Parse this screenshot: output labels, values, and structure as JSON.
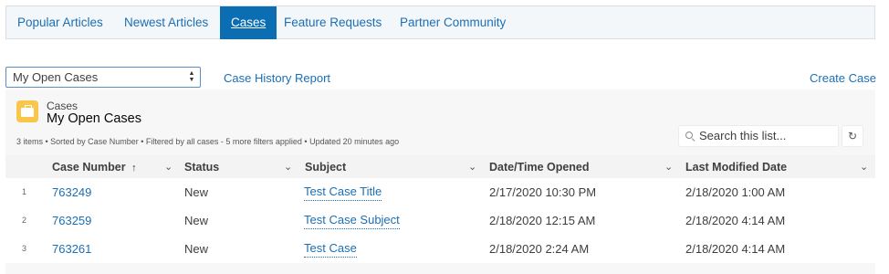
{
  "nav": {
    "tabs": [
      {
        "label": "Popular Articles"
      },
      {
        "label": "Newest Articles"
      },
      {
        "label": "Cases"
      },
      {
        "label": "Feature Requests"
      },
      {
        "label": "Partner Community"
      }
    ],
    "active_tab": "Cases"
  },
  "controls": {
    "list_select_value": "My Open Cases",
    "case_history_link": "Case History Report",
    "create_case_link": "Create Case"
  },
  "list_view": {
    "object_label": "Cases",
    "title": "My Open Cases",
    "meta": "3 items • Sorted by Case Number • Filtered by all cases - 5 more filters applied • Updated 20 minutes ago",
    "search_placeholder": "Search this list...",
    "icon": "briefcase-icon"
  },
  "table": {
    "columns": [
      {
        "label": "Case Number",
        "sorted": "ascending"
      },
      {
        "label": "Status"
      },
      {
        "label": "Subject"
      },
      {
        "label": "Date/Time Opened"
      },
      {
        "label": "Last Modified Date"
      }
    ],
    "sort_indicator": "↑",
    "rows": [
      {
        "num": "1",
        "case_number": "763249",
        "status": "New",
        "subject": "Test Case Title",
        "opened": "2/17/2020 10:30 PM",
        "modified": "2/18/2020 1:00 AM"
      },
      {
        "num": "2",
        "case_number": "763259",
        "status": "New",
        "subject": "Test Case Subject",
        "opened": "2/18/2020 12:15 AM",
        "modified": "2/18/2020 4:14 AM"
      },
      {
        "num": "3",
        "case_number": "763261",
        "status": "New",
        "subject": "Test Case",
        "opened": "2/18/2020 2:24 AM",
        "modified": "2/18/2020 4:14 AM"
      }
    ]
  },
  "colors": {
    "link": "#1b6fb5",
    "active_tab_bg": "#0b6eb3",
    "nav_bg": "#f3f7fa",
    "icon_yellow": "#f9c649"
  }
}
